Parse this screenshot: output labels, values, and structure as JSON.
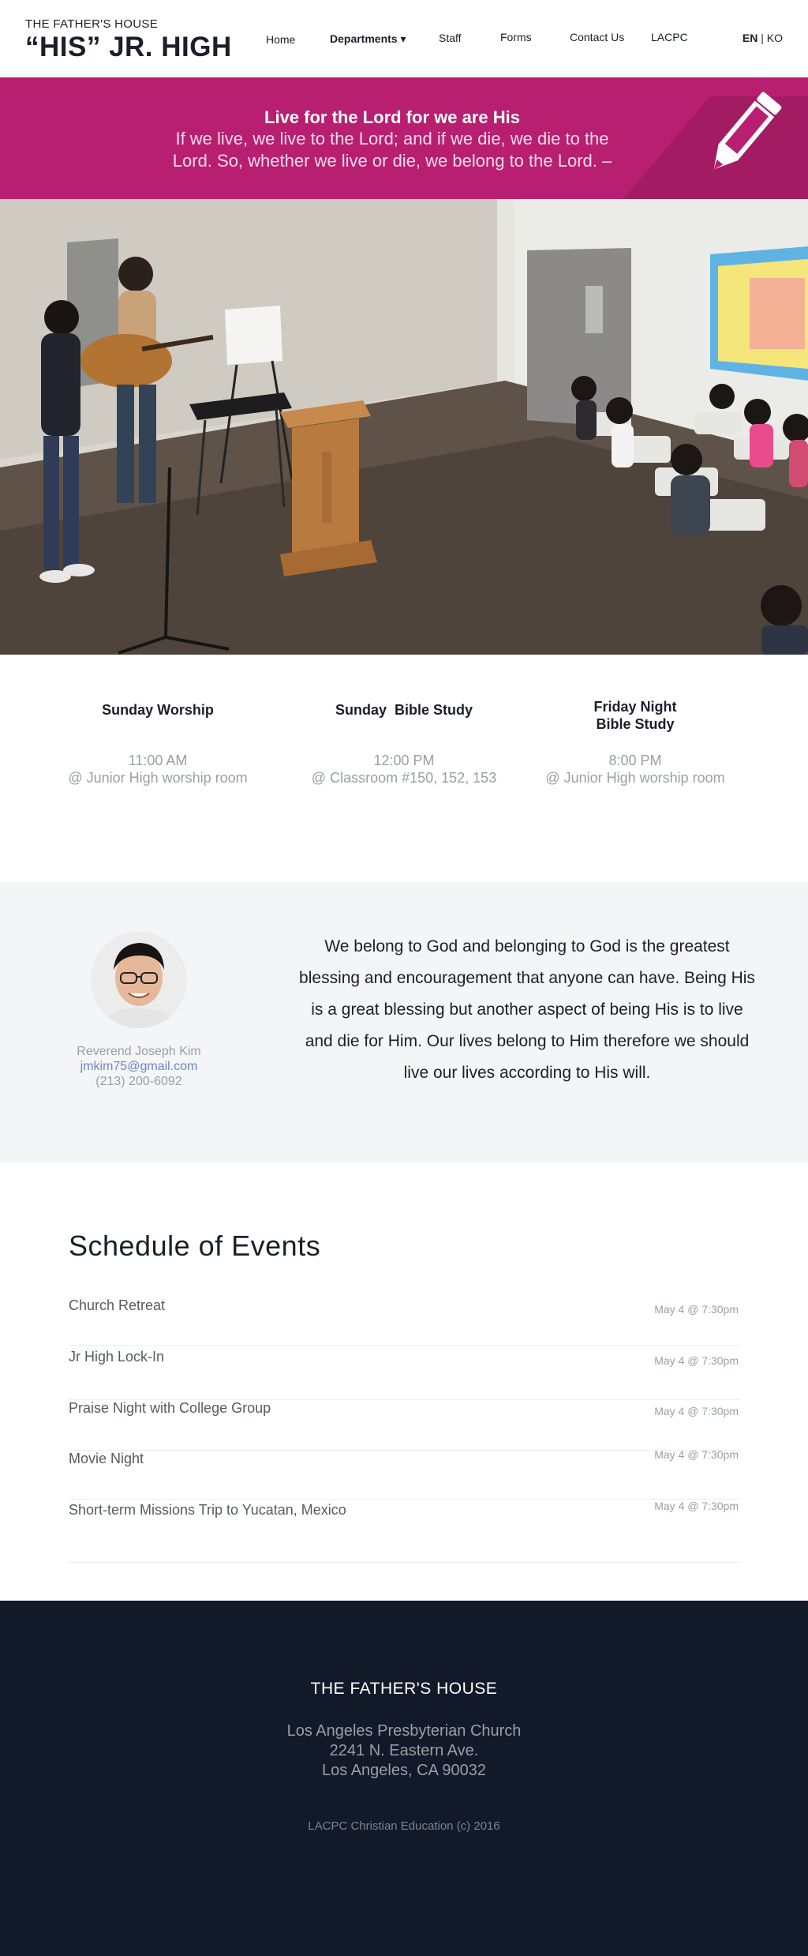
{
  "brand": {
    "top": "THE FATHER'S HOUSE",
    "main": "“HIS” JR. HIGH"
  },
  "nav": {
    "items": [
      {
        "label": "Home"
      },
      {
        "label": "Departments ▾"
      },
      {
        "label": "Staff"
      },
      {
        "label": "Forms"
      },
      {
        "label": "Contact Us"
      },
      {
        "label": "LACPC"
      }
    ],
    "lang_en": "EN",
    "lang_sep": "|",
    "lang_ko": "KO"
  },
  "banner": {
    "title": "Live for the Lord for we are His",
    "text": "If we live, we live to the Lord; and if we die, we die to the Lord. So, whether we live or die, we belong to the Lord. –",
    "icon": "pencil-icon"
  },
  "services": [
    {
      "title": "Sunday Worship",
      "time": "11:00 AM",
      "place": "@ Junior High worship room"
    },
    {
      "title": "Sunday  Bible Study",
      "time": "12:00 PM",
      "place": "@ Classroom #150, 152, 153"
    },
    {
      "title": "Friday Night\nBible Study",
      "time": "8:00 PM",
      "place": "@ Junior High worship room"
    }
  ],
  "pastor": {
    "name": "Reverend Joseph Kim",
    "email": "jmkim75@gmail.com",
    "phone": "(213) 200-6092",
    "quote": "We belong to God and belonging to God is the greatest blessing and encouragement that anyone can have. Being His is a great blessing but another aspect of being His is to live and die for Him. Our lives belong to Him therefore we should live our lives according to His will."
  },
  "events": {
    "title": "Schedule of Events",
    "items": [
      {
        "name": "Church Retreat",
        "date": "May 4 @ 7:30pm"
      },
      {
        "name": "Jr High Lock-In",
        "date": "May 4 @ 7:30pm"
      },
      {
        "name": "Praise Night with College Group",
        "date": "May 4 @ 7:30pm"
      },
      {
        "name": "Movie Night",
        "date": "May 4 @ 7:30pm"
      },
      {
        "name": "Short-term Missions Trip to Yucatan, Mexico",
        "date": "May 4 @ 7:30pm"
      }
    ]
  },
  "footer": {
    "title": "THE FATHER'S HOUSE",
    "address_1": "Los Angeles Presbyterian Church",
    "address_2": "2241 N. Eastern Ave.",
    "address_3": "Los Angeles, CA 90032",
    "copyright": "LACPC Christian Education (c) 2016"
  },
  "colors": {
    "banner": "#b81f70",
    "footer": "#121a2a",
    "section_gray": "#f4f5f7",
    "link": "#6b86c6"
  }
}
